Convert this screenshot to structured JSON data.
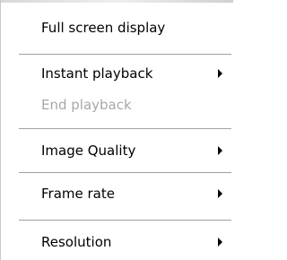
{
  "menu": {
    "items": [
      {
        "label": "Full screen display"
      },
      {
        "label": "Instant playback",
        "submenu_icon": "chevron-right-icon"
      },
      {
        "label": "End playback",
        "disabled": true
      },
      {
        "label": "Image Quality",
        "submenu_icon": "chevron-right-icon"
      },
      {
        "label": "Frame rate",
        "submenu_icon": "chevron-right-icon"
      },
      {
        "label": "Resolution",
        "submenu_icon": "chevron-right-icon"
      }
    ]
  }
}
